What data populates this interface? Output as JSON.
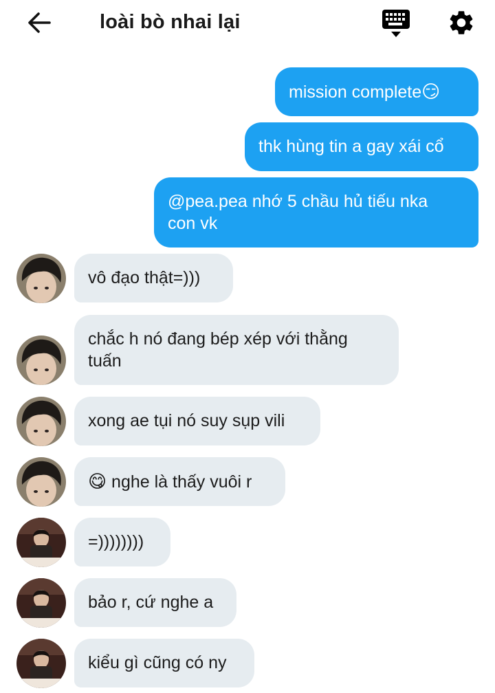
{
  "header": {
    "title": "loài bò nhai lại",
    "back_icon": "arrow-left-icon",
    "keyboard_icon": "keyboard-icon",
    "settings_icon": "gear-icon"
  },
  "colors": {
    "outgoing_bubble": "#1da1f2",
    "incoming_bubble": "#e6ecf0"
  },
  "messages": {
    "m1": {
      "text": "mission complete",
      "emoji": "😏"
    },
    "m2": {
      "text": "thk hùng tin a gay xái cổ"
    },
    "m3": {
      "line1": "@pea.pea nhớ 5 chầu hủ tiếu nka",
      "line2": "con vk"
    },
    "m4": {
      "text": "vô đạo thật=)))"
    },
    "m5": {
      "line1": "chắc h nó đang bép xép với thằng",
      "line2": "tuấn"
    },
    "m6": {
      "text": "xong ae tụi nó suy sụp vili"
    },
    "m7": {
      "emoji": "😋",
      "text": " nghe là thấy vuôi r"
    },
    "m8": {
      "text": "=))))))))"
    },
    "m9": {
      "text": "bảo r, cứ nghe a"
    },
    "m10": {
      "text": "kiểu gì cũng có ny"
    }
  }
}
